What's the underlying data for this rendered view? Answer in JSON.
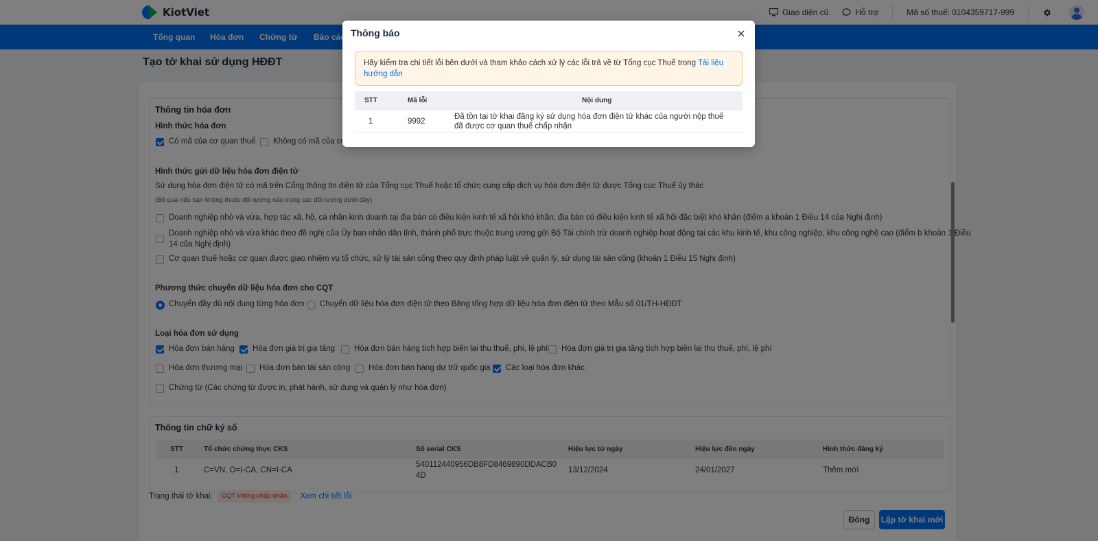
{
  "topbar": {
    "logo_text": "KiotViet",
    "old_ui_label": "Giao diện cũ",
    "support_label": "Hỗ trợ",
    "tax_code_label": "Mã số thuế: 0104359717-999",
    "icons": [
      "monitor-icon",
      "chat-icon",
      "gear-icon",
      "user-avatar-icon"
    ]
  },
  "nav": {
    "items": [
      "Tổng quan",
      "Hóa đơn",
      "Chứng từ",
      "Báo cáo"
    ]
  },
  "page": {
    "title": "Tạo tờ khai sử dụng HĐĐT"
  },
  "invoice_info": {
    "section_title": "Thông tin hóa đơn",
    "form_label": "Hình thức hóa đơn",
    "form_options": [
      {
        "label": "Có mã của cơ quan thuế",
        "checked": true
      },
      {
        "label": "Không có mã của cơ",
        "checked": false
      }
    ],
    "send_method_title": "Hình thức gửi dữ liệu hóa đơn điện tử",
    "send_method_desc": "Sử dụng hóa đơn điện tử có mã trên Cổng thông tin điện tử của Tổng cục Thuế hoặc tổ chức cung cấp dịch vụ hóa đơn điện tử được Tổng cục Thuế ủy thác",
    "send_method_note": "(Bỏ qua nếu bạn không thuộc đối tượng nào trong các đối tượng dưới đây)",
    "send_options": [
      {
        "label": "Doanh nghiệp nhỏ và vừa, hợp tác xã, hộ, cá nhân kinh doanh tại địa bàn có điều kiện kinh tế xã hội khó khăn, địa bàn có điều kiện kinh tế xã hội đặc biệt khó khăn (điểm a khoản 1 Điều 14 của Nghị định)",
        "checked": false
      },
      {
        "label_line1": "Doanh nghiệp nhỏ và vừa khác theo đề nghị của Ủy ban nhân dân tỉnh, thành phố trực thuộc trung ương gửi Bộ Tài chính trừ doanh nghiệp hoạt động tại các khu kinh tế, khu công nghiệp, khu công nghệ cao (điểm b khoản 1 Điều",
        "label_line2": "14 của Nghị định)",
        "checked": false
      },
      {
        "label": "Cơ quan thuế hoặc cơ quan được giao nhiệm vụ tổ chức, xử lý tài sản công theo quy định pháp luật về quản lý, sử dụng tài sản công (khoản 1 Điều 15 Nghị định)",
        "checked": false
      }
    ],
    "transfer_title": "Phương thức chuyển dữ liệu hóa đơn cho CQT",
    "transfer_options": [
      {
        "label": "Chuyển đầy đủ nội dung từng hóa đơn",
        "selected": true
      },
      {
        "label": "Chuyển dữ liệu hóa đơn điện tử theo Bảng tổng hợp dữ liệu hóa đơn điện tử theo Mẫu số 01/TH-HĐĐT",
        "selected": false
      }
    ],
    "types_title": "Loại hóa đơn sử dụng",
    "types": [
      {
        "label": "Hóa đơn bán hàng",
        "checked": true
      },
      {
        "label": "Hóa đơn giá trị gia tăng",
        "checked": true
      },
      {
        "label": "Hóa đơn bán hàng tích hợp biên lai thu thuế, phí, lệ phí",
        "checked": false
      },
      {
        "label": "Hóa đơn giá trị gia tăng tích hợp biên lai thu thuế, phí, lệ phí",
        "checked": false
      },
      {
        "label": "Hóa đơn thương mại",
        "checked": false
      },
      {
        "label": "Hóa đơn bán tài sản công",
        "checked": false
      },
      {
        "label": "Hóa đơn bán hàng dự trữ quốc gia",
        "checked": false
      },
      {
        "label": "Các loại hóa đơn khác",
        "checked": true
      },
      {
        "label": "Chứng từ (Các chứng từ được in, phát hành, sử dụng và quản lý như hóa đơn)",
        "checked": false
      }
    ]
  },
  "signature_info": {
    "section_title": "Thông tin chữ ký số",
    "headers": [
      "STT",
      "Tổ chức chứng thực CKS",
      "Số serial CKS",
      "Hiệu lực từ ngày",
      "Hiệu lực đến ngày",
      "Hình thức đăng ký"
    ],
    "rows": [
      {
        "stt": "1",
        "org": "C=VN, O=I-CA, CN=I-CA",
        "serial_line1": "540112440956DB8FD8469890DDACB0",
        "serial_line2": "4D",
        "from": "13/12/2024",
        "to": "24/01/2027",
        "type": "Thêm mới"
      }
    ]
  },
  "footer": {
    "status_label": "Trạng thái tờ khai:",
    "status_badge": "CQT không chấp nhận",
    "view_errors_label": "Xem chi tiết lỗi",
    "close_label": "Đóng",
    "new_label": "Lập tờ khai mới"
  },
  "modal": {
    "title": "Thông báo",
    "alert_text": "Hãy kiểm tra chi tiết lỗi bên dưới và tham khảo cách xử lý các lỗi trả về từ Tổng cục Thuế trong ",
    "alert_link": "Tài liệu hướng dẫn",
    "headers": [
      "STT",
      "Mã lỗi",
      "Nội dung"
    ],
    "rows": [
      {
        "stt": "1",
        "code": "9992",
        "content": "Đã tồn tại tờ khai đăng ký sử dụng hóa đơn điện tử khác của người nộp thuế đã được cơ quan thuế chấp nhận"
      }
    ]
  },
  "colors": {
    "brand_blue": "#0070f4",
    "brand_green": "#00b63e",
    "alert_bg": "#fff5e6",
    "alert_border": "#f7c97a",
    "error_red": "#d92b2b"
  }
}
